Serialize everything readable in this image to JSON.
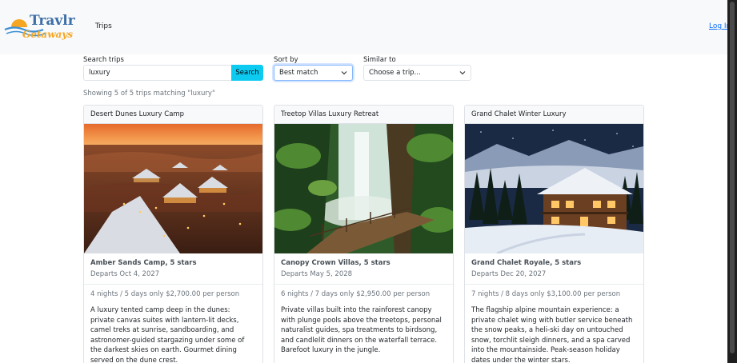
{
  "nav": {
    "brand_top": "Travlr",
    "brand_bottom": "Getaways",
    "trips": "Trips",
    "login": "Log In"
  },
  "controls": {
    "search_label": "Search trips",
    "search_value": "luxury",
    "search_button": "Search",
    "sort_label": "Sort by",
    "sort_value": "Best match",
    "similar_label": "Similar to",
    "similar_value": "Choose a trip..."
  },
  "status": "Showing 5 of 5 trips matching \"luxury\"",
  "cards": [
    {
      "header": "Desert Dunes Luxury Camp",
      "title": "Amber Sands Camp, 5 stars",
      "date": "Departs Oct 4, 2027",
      "price": "4 nights / 5 days only $2,700.00 per person",
      "desc": "A luxury tented camp deep in the dunes: private canvas suites with lantern-lit decks, camel treks at sunrise, sandboarding, and astronomer-guided stargazing under some of the darkest skies on earth. Gourmet dining served on the dune crest."
    },
    {
      "header": "Treetop Villas Luxury Retreat",
      "title": "Canopy Crown Villas, 5 stars",
      "date": "Departs May 5, 2028",
      "price": "6 nights / 7 days only $2,950.00 per person",
      "desc": "Private villas built into the rainforest canopy with plunge pools above the treetops, personal naturalist guides, spa treatments to birdsong, and candlelit dinners on the waterfall terrace. Barefoot luxury in the jungle."
    },
    {
      "header": "Grand Chalet Winter Luxury",
      "title": "Grand Chalet Royale, 5 stars",
      "date": "Departs Dec 20, 2027",
      "price": "7 nights / 8 days only $3,100.00 per person",
      "desc": "The flagship alpine mountain experience: a private chalet wing with butler service beneath the snow peaks, a heli-ski day on untouched snow, torchlit sleigh dinners, and a spa carved into the mountainside. Peak-season holiday dates under the winter stars."
    }
  ]
}
